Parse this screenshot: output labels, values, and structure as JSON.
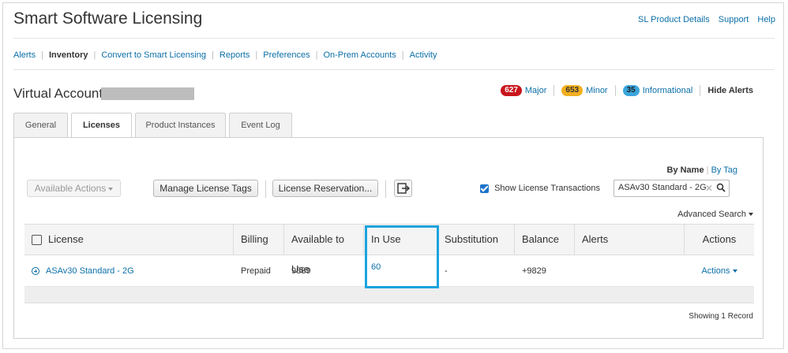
{
  "app": {
    "title": "Smart Software Licensing"
  },
  "top_links": [
    "SL Product Details",
    "Support",
    "Help"
  ],
  "nav": {
    "items": [
      "Alerts",
      "Inventory",
      "Convert to Smart Licensing",
      "Reports",
      "Preferences",
      "On-Prem Accounts",
      "Activity"
    ],
    "active": "Inventory"
  },
  "virtual_account": {
    "label": "Virtual Account:"
  },
  "alerts": {
    "major": {
      "count": "627",
      "label": "Major"
    },
    "minor": {
      "count": "653",
      "label": "Minor"
    },
    "info": {
      "count": "35",
      "label": "Informational"
    },
    "hide": "Hide Alerts"
  },
  "tabs": [
    {
      "label": "General"
    },
    {
      "label": "Licenses"
    },
    {
      "label": "Product Instances"
    },
    {
      "label": "Event Log"
    }
  ],
  "toolbar": {
    "by_name": "By Name",
    "by_tag": "By Tag",
    "available_actions": "Available Actions",
    "manage_tags": "Manage License Tags",
    "reservation": "License Reservation...",
    "show_transactions": "Show License Transactions",
    "show_transactions_checked": true,
    "search_value": "ASAv30 Standard - 2G",
    "advanced_search": "Advanced Search"
  },
  "table": {
    "columns": [
      "License",
      "Billing",
      "Available to Use",
      "In Use",
      "Substitution",
      "Balance",
      "Alerts",
      "Actions"
    ],
    "rows": [
      {
        "license": "ASAv30 Standard - 2G",
        "billing": "Prepaid",
        "available": "9889",
        "in_use": "60",
        "substitution": "-",
        "balance": "+9829",
        "alerts": "",
        "actions": "Actions"
      }
    ],
    "footer": "Showing 1 Record"
  },
  "colors": {
    "link": "#0b6fa8",
    "highlight": "#1aa3df",
    "major": "#c9161d",
    "minor": "#f2b01e",
    "info": "#3aa5dc"
  }
}
